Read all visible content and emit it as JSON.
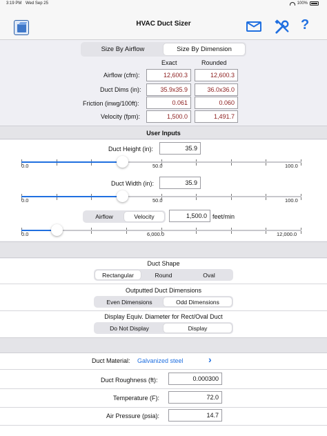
{
  "status_bar": {
    "time": "3:19 PM",
    "date": "Wed Sep 25",
    "battery": "100%"
  },
  "header": {
    "title": "HVAC Duct Sizer",
    "help": "?"
  },
  "mode_tabs": [
    {
      "label": "Size By Airflow",
      "selected": false
    },
    {
      "label": "Size By Dimension",
      "selected": true
    }
  ],
  "results": {
    "col_exact": "Exact",
    "col_rounded": "Rounded",
    "rows": [
      {
        "label": "Airflow (cfm):",
        "exact": "12,600.3",
        "rounded": "12,600.3"
      },
      {
        "label": "Duct Dims (in):",
        "exact": "35.9x35.9",
        "rounded": "36.0x36.0"
      },
      {
        "label": "Friction (inwg/100ft):",
        "exact": "0.061",
        "rounded": "0.060"
      },
      {
        "label": "Velocity (fpm):",
        "exact": "1,500.0",
        "rounded": "1,491.7"
      }
    ]
  },
  "inputs": {
    "title": "User Inputs",
    "duct_height": {
      "label": "Duct Height (in):",
      "value": "35.9",
      "min": "0.0",
      "mid": "50.0",
      "max": "100.0",
      "level": 0.359
    },
    "duct_width": {
      "label": "Duct Width (in):",
      "value": "35.9",
      "min": "0.0",
      "mid": "50.0",
      "max": "100.0",
      "level": 0.359
    },
    "flow_mode": [
      {
        "label": "Airflow",
        "selected": false
      },
      {
        "label": "Velocity",
        "selected": true
      }
    ],
    "velocity": {
      "value": "1,500.0",
      "unit": "feet/min",
      "min": "0.0",
      "mid": "6,000.0",
      "max": "12,000.0",
      "level": 0.125
    }
  },
  "shape": {
    "title": "Duct Shape",
    "options": [
      {
        "label": "Rectangular",
        "selected": true
      },
      {
        "label": "Round",
        "selected": false
      },
      {
        "label": "Oval",
        "selected": false
      }
    ]
  },
  "output_dims": {
    "title": "Outputted Duct Dimensions",
    "options": [
      {
        "label": "Even Dimensions",
        "selected": false
      },
      {
        "label": "Odd Dimensions",
        "selected": true
      }
    ]
  },
  "equiv_diameter": {
    "title": "Display Equiv. Diameter for Rect/Oval Duct",
    "options": [
      {
        "label": "Do Not Display",
        "selected": false
      },
      {
        "label": "Display",
        "selected": true
      }
    ]
  },
  "properties": {
    "material_label": "Duct Material:",
    "material_value": "Galvanized steel",
    "roughness_label": "Duct Roughness (ft):",
    "roughness_value": "0.000300",
    "temperature_label": "Temperature (F):",
    "temperature_value": "72.0",
    "pressure_label": "Air Pressure (psia):",
    "pressure_value": "14.7"
  },
  "colors": {
    "accent": "#1f6fe0",
    "result_text": "#8b1c1c",
    "background": "#efeff4"
  }
}
